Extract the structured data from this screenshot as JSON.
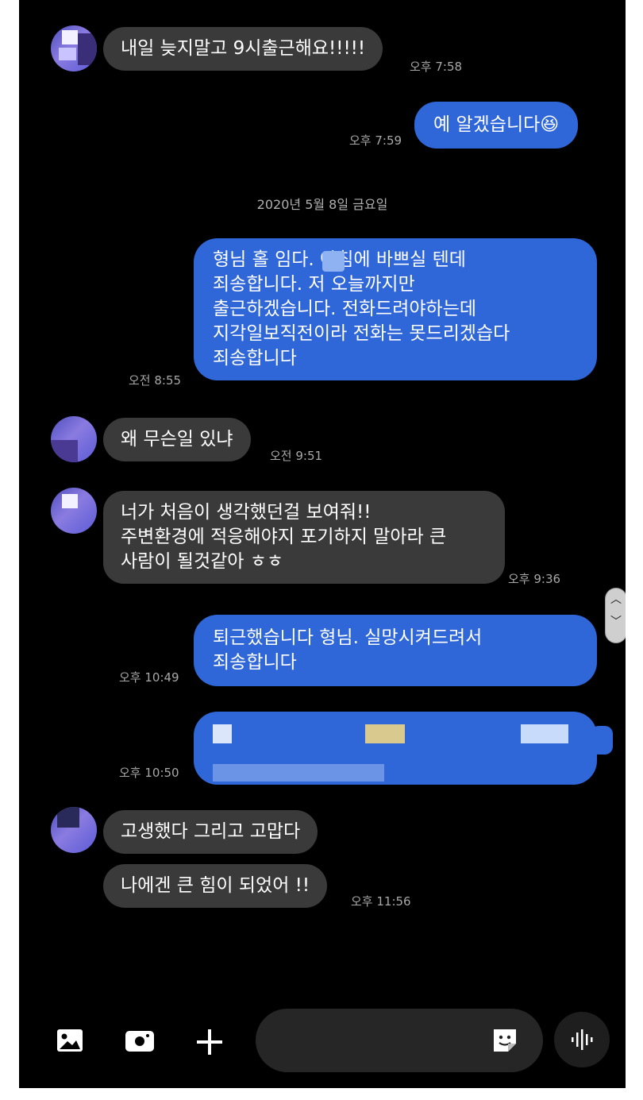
{
  "header": {
    "date_partial": ""
  },
  "messages": [
    {
      "id": "m1",
      "side": "in",
      "text": "내일 늦지말고 9시출근해요!!!!!",
      "time": "오후 7:58"
    },
    {
      "id": "m2",
      "side": "out",
      "text": "예 알겠습니다😆",
      "time": "오후 7:59"
    },
    {
      "id": "m3",
      "side": "out",
      "text": "형님 홀       임다. 아침에 바쁘실 텐데\n죄송합니다. 저 오늘까지만\n출근하겠습니다. 전화드려야하는데\n지각일보직전이라 전화는 못드리겠습다\n죄송합니다",
      "time": "오전 8:55"
    },
    {
      "id": "m4",
      "side": "in",
      "text": "왜 무슨일 있냐",
      "time": "오전 9:51"
    },
    {
      "id": "m5",
      "side": "in",
      "text": "너가 처음이 생각했던걸 보여줘!!\n주변환경에 적응해야지 포기하지 말아라 큰\n사람이 될것같아 ㅎㅎ",
      "time": "오후 9:36"
    },
    {
      "id": "m6",
      "side": "out",
      "text": "퇴근했습니다 형님. 실망시켜드려서\n죄송합니다",
      "time": "오후 10:49"
    },
    {
      "id": "m7",
      "side": "out",
      "text": "",
      "time": "오후 10:50"
    },
    {
      "id": "m8",
      "side": "in",
      "text": "고생했다 그리고 고맙다",
      "time": ""
    },
    {
      "id": "m9",
      "side": "in",
      "text": "나에겐 큰 힘이 되었어 !!",
      "time": "오후 11:56"
    }
  ],
  "date_separator": "2020년 5월 8일 금요일",
  "composer": {
    "placeholder": "",
    "icons": [
      "gallery-icon",
      "camera-icon",
      "plus-icon",
      "sticker-icon",
      "voice-icon"
    ]
  },
  "colors": {
    "incoming_bubble": "#3a3a3a",
    "outgoing_bubble": "#2f67d8",
    "background": "#000000"
  }
}
